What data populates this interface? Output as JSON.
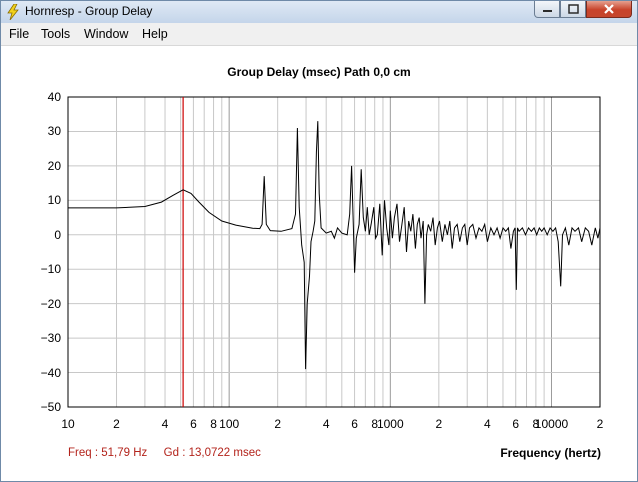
{
  "window": {
    "title": "Hornresp - Group Delay",
    "app_icon": "lightning-bolt-icon"
  },
  "menu": [
    "File",
    "Tools",
    "Window",
    "Help"
  ],
  "chart_title": "Group Delay (msec)   Path 0,0 cm",
  "status": {
    "freq": "Freq : 51,79 Hz",
    "gd": "Gd : 13,0722 msec"
  },
  "colors": {
    "marker": "#cc0000",
    "status_text": "#b3231b",
    "grid": "#c8c8c8",
    "trace": "#000000"
  },
  "chart_data": {
    "type": "line",
    "xlabel": "Frequency (hertz)",
    "ylabel": "",
    "xscale": "log",
    "xlim": [
      10,
      20000
    ],
    "ylim": [
      -50,
      40
    ],
    "y_ticks": [
      "40",
      "30",
      "20",
      "10",
      "0",
      "−10",
      "−20",
      "−30",
      "−40",
      "−50"
    ],
    "x_ticks": [
      {
        "label": "10",
        "value": 10
      },
      {
        "label": "2",
        "value": 20
      },
      {
        "label": "4",
        "value": 40
      },
      {
        "label": "6",
        "value": 60
      },
      {
        "label": "8",
        "value": 80
      },
      {
        "label": "100",
        "value": 100
      },
      {
        "label": "2",
        "value": 200
      },
      {
        "label": "4",
        "value": 400
      },
      {
        "label": "6",
        "value": 600
      },
      {
        "label": "8",
        "value": 800
      },
      {
        "label": "1000",
        "value": 1000
      },
      {
        "label": "2",
        "value": 2000
      },
      {
        "label": "4",
        "value": 4000
      },
      {
        "label": "6",
        "value": 6000
      },
      {
        "label": "8",
        "value": 8000
      },
      {
        "label": "10000",
        "value": 10000
      },
      {
        "label": "2",
        "value": 20000
      }
    ],
    "marker_freq": 51.79,
    "grid": true,
    "series": [
      {
        "points": [
          [
            10,
            7.8
          ],
          [
            20,
            7.8
          ],
          [
            30,
            8.2
          ],
          [
            38,
            9.5
          ],
          [
            45,
            11.5
          ],
          [
            51.79,
            13.07
          ],
          [
            58,
            12.0
          ],
          [
            65,
            9.5
          ],
          [
            75,
            6.5
          ],
          [
            90,
            4.0
          ],
          [
            110,
            2.8
          ],
          [
            140,
            1.9
          ],
          [
            155,
            1.8
          ],
          [
            160,
            3
          ],
          [
            165,
            17
          ],
          [
            170,
            3
          ],
          [
            180,
            1.2
          ],
          [
            210,
            1.0
          ],
          [
            245,
            1.8
          ],
          [
            258,
            6
          ],
          [
            265,
            31
          ],
          [
            272,
            8
          ],
          [
            282,
            -3
          ],
          [
            292,
            -8
          ],
          [
            298,
            -39
          ],
          [
            305,
            -20
          ],
          [
            315,
            -12
          ],
          [
            322,
            -2
          ],
          [
            332,
            1
          ],
          [
            340,
            4
          ],
          [
            348,
            24
          ],
          [
            355,
            33
          ],
          [
            362,
            12
          ],
          [
            372,
            2
          ],
          [
            400,
            0.5
          ],
          [
            430,
            1
          ],
          [
            450,
            -1
          ],
          [
            470,
            2
          ],
          [
            500,
            0.5
          ],
          [
            540,
            0
          ],
          [
            560,
            6
          ],
          [
            575,
            20
          ],
          [
            590,
            2
          ],
          [
            600,
            -11
          ],
          [
            615,
            -1
          ],
          [
            640,
            3
          ],
          [
            660,
            19
          ],
          [
            680,
            5
          ],
          [
            700,
            1
          ],
          [
            720,
            8
          ],
          [
            740,
            0
          ],
          [
            760,
            3
          ],
          [
            790,
            8
          ],
          [
            810,
            -1
          ],
          [
            830,
            0
          ],
          [
            860,
            9
          ],
          [
            890,
            -6
          ],
          [
            920,
            10
          ],
          [
            950,
            2
          ],
          [
            980,
            -3
          ],
          [
            1000,
            7
          ],
          [
            1030,
            -1
          ],
          [
            1060,
            5
          ],
          [
            1100,
            9
          ],
          [
            1140,
            -2
          ],
          [
            1180,
            3
          ],
          [
            1220,
            8
          ],
          [
            1260,
            -5
          ],
          [
            1300,
            4
          ],
          [
            1340,
            1
          ],
          [
            1380,
            6
          ],
          [
            1430,
            -4
          ],
          [
            1470,
            3
          ],
          [
            1510,
            5
          ],
          [
            1550,
            -1
          ],
          [
            1600,
            4
          ],
          [
            1640,
            -20
          ],
          [
            1680,
            0
          ],
          [
            1720,
            3
          ],
          [
            1780,
            1
          ],
          [
            1840,
            5
          ],
          [
            1900,
            -3
          ],
          [
            1960,
            2
          ],
          [
            2020,
            4
          ],
          [
            2100,
            -2
          ],
          [
            2180,
            3
          ],
          [
            2260,
            0
          ],
          [
            2340,
            4
          ],
          [
            2420,
            -4
          ],
          [
            2500,
            2
          ],
          [
            2600,
            3
          ],
          [
            2700,
            -2
          ],
          [
            2800,
            2
          ],
          [
            2900,
            3
          ],
          [
            3000,
            -3
          ],
          [
            3100,
            2
          ],
          [
            3250,
            3
          ],
          [
            3400,
            -1
          ],
          [
            3550,
            2
          ],
          [
            3700,
            1
          ],
          [
            3850,
            3
          ],
          [
            4000,
            -2
          ],
          [
            4200,
            2
          ],
          [
            4400,
            0
          ],
          [
            4600,
            2
          ],
          [
            4800,
            -1
          ],
          [
            5000,
            2
          ],
          [
            5200,
            1
          ],
          [
            5400,
            2
          ],
          [
            5600,
            -4
          ],
          [
            5800,
            1
          ],
          [
            5950,
            2
          ],
          [
            6050,
            -16
          ],
          [
            6150,
            2
          ],
          [
            6300,
            1
          ],
          [
            6600,
            2
          ],
          [
            6900,
            0
          ],
          [
            7200,
            2
          ],
          [
            7500,
            1
          ],
          [
            7800,
            2
          ],
          [
            8100,
            0
          ],
          [
            8400,
            2
          ],
          [
            8700,
            1
          ],
          [
            9000,
            2
          ],
          [
            9400,
            0
          ],
          [
            9800,
            2
          ],
          [
            10200,
            1
          ],
          [
            10600,
            2
          ],
          [
            11000,
            -2
          ],
          [
            11400,
            -15
          ],
          [
            11700,
            0
          ],
          [
            12200,
            2
          ],
          [
            12800,
            -3
          ],
          [
            13400,
            2
          ],
          [
            14000,
            1
          ],
          [
            14700,
            2
          ],
          [
            15400,
            -2
          ],
          [
            16200,
            2
          ],
          [
            17000,
            1
          ],
          [
            17800,
            -3
          ],
          [
            18700,
            2
          ],
          [
            19400,
            -1
          ],
          [
            20000,
            2
          ]
        ]
      }
    ]
  }
}
